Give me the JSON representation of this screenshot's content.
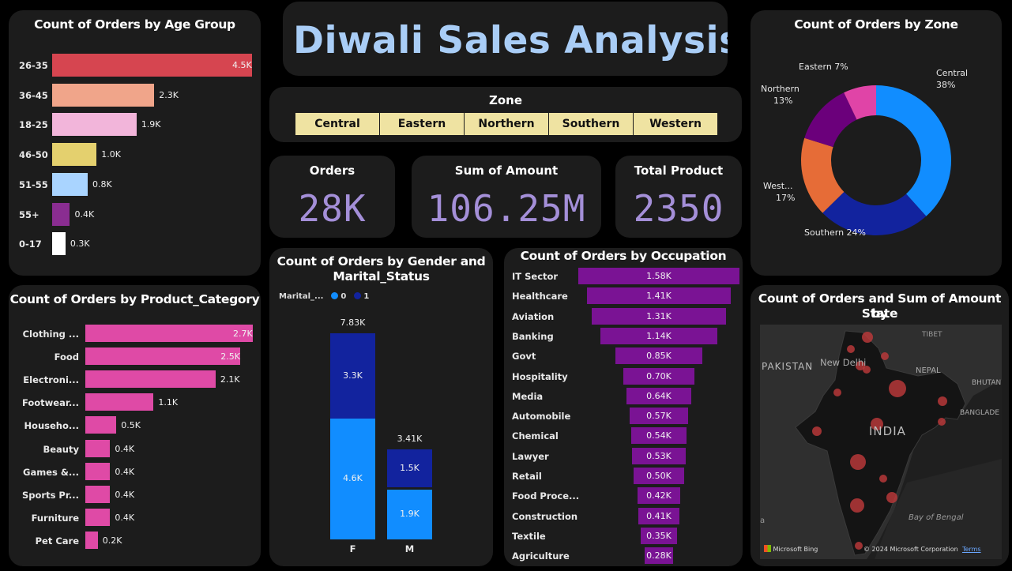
{
  "title": "Diwali Sales Analysis",
  "colors": {
    "background": "#000000",
    "card": "#1c1c1c",
    "title_text": "#a9cdf6",
    "kpi_value": "#a48fd8",
    "slicer_item": "#efe3a2",
    "category_bar": "#df4aa6",
    "occupation_bar": "#7a1394",
    "gender_0": "#118dff",
    "gender_1": "#12239e"
  },
  "zone_slicer": {
    "title": "Zone",
    "items": [
      "Central",
      "Eastern",
      "Northern",
      "Southern",
      "Western"
    ]
  },
  "kpis": {
    "orders": {
      "label": "Orders",
      "value": "28K"
    },
    "amount": {
      "label": "Sum of Amount",
      "value": "106.25M"
    },
    "products": {
      "label": "Total Product",
      "value": "2350"
    }
  },
  "age_chart": {
    "title": "Count of Orders by Age Group",
    "chart_data": {
      "type": "bar",
      "orientation": "horizontal",
      "categories": [
        "26-35",
        "36-45",
        "18-25",
        "46-50",
        "51-55",
        "55+",
        "0-17"
      ],
      "values": [
        4.5,
        2.3,
        1.9,
        1.0,
        0.8,
        0.4,
        0.3
      ],
      "unit": "K",
      "labels": [
        "4.5K",
        "2.3K",
        "1.9K",
        "1.0K",
        "0.8K",
        "0.4K",
        "0.3K"
      ],
      "colors": [
        "#d64550",
        "#f0a58a",
        "#f2b5da",
        "#e4d06e",
        "#a9d4ff",
        "#8a2d91",
        "#ffffff"
      ]
    }
  },
  "category_chart": {
    "title": "Count of Orders by Product_Category",
    "chart_data": {
      "type": "bar",
      "orientation": "horizontal",
      "categories": [
        "Clothing ...",
        "Food",
        "Electroni...",
        "Footwear...",
        "Househo...",
        "Beauty",
        "Games &...",
        "Sports Pr...",
        "Furniture",
        "Pet Care"
      ],
      "values": [
        2.7,
        2.5,
        2.1,
        1.1,
        0.5,
        0.4,
        0.4,
        0.4,
        0.4,
        0.2
      ],
      "unit": "K",
      "labels": [
        "2.7K",
        "2.5K",
        "2.1K",
        "1.1K",
        "0.5K",
        "0.4K",
        "0.4K",
        "0.4K",
        "0.4K",
        "0.2K"
      ]
    }
  },
  "gender_chart": {
    "title_line1": "Count of Orders by Gender and",
    "title_line2": "Marital_Status",
    "legend_title": "Marital_...",
    "chart_data": {
      "type": "bar",
      "stacked": true,
      "categories": [
        "F",
        "M"
      ],
      "series": [
        {
          "name": "0",
          "values": [
            4.6,
            1.9
          ],
          "labels": [
            "4.6K",
            "1.9K"
          ]
        },
        {
          "name": "1",
          "values": [
            3.3,
            1.5
          ],
          "labels": [
            "3.3K",
            "1.5K"
          ]
        }
      ],
      "totals": [
        7.83,
        3.41
      ],
      "total_labels": [
        "7.83K",
        "3.41K"
      ],
      "unit": "K"
    }
  },
  "occupation_chart": {
    "title": "Count of Orders by Occupation",
    "chart_data": {
      "type": "bar",
      "orientation": "horizontal",
      "style": "funnel",
      "categories": [
        "IT Sector",
        "Healthcare",
        "Aviation",
        "Banking",
        "Govt",
        "Hospitality",
        "Media",
        "Automobile",
        "Chemical",
        "Lawyer",
        "Retail",
        "Food Proce...",
        "Construction",
        "Textile",
        "Agriculture"
      ],
      "values": [
        1.58,
        1.41,
        1.31,
        1.14,
        0.85,
        0.7,
        0.64,
        0.57,
        0.54,
        0.53,
        0.5,
        0.42,
        0.41,
        0.35,
        0.28
      ],
      "unit": "K",
      "labels": [
        "1.58K",
        "1.41K",
        "1.31K",
        "1.14K",
        "0.85K",
        "0.70K",
        "0.64K",
        "0.57K",
        "0.54K",
        "0.53K",
        "0.50K",
        "0.42K",
        "0.41K",
        "0.35K",
        "0.28K"
      ]
    }
  },
  "zone_chart": {
    "title": "Count of Orders by Zone",
    "chart_data": {
      "type": "pie",
      "donut": true,
      "categories": [
        "Central",
        "Southern",
        "Western",
        "Northern",
        "Eastern"
      ],
      "values": [
        38,
        24,
        17,
        13,
        7
      ],
      "unit": "%",
      "colors": [
        "#118dff",
        "#12239e",
        "#e66c37",
        "#6b007b",
        "#e044a7"
      ],
      "label_names": [
        "Central",
        "Southern",
        "West...",
        "Northern",
        "Eastern"
      ],
      "label_values": [
        "38%",
        "24%",
        "17%",
        "13%",
        "7%"
      ]
    }
  },
  "map_chart": {
    "title_line1": "Count of Orders and Sum of Amount by",
    "title_line2": "State",
    "map_labels": {
      "pakistan": "PAKISTAN",
      "new_delhi": "New Delhi",
      "nepal": "NEPAL",
      "tibet": "TIBET",
      "bhutan": "BHUTAN",
      "bangladesh": "BANGLADE",
      "india": "INDIA",
      "bay_of_bengal": "Bay of Bengal",
      "edge_a": "a"
    },
    "attribution": "Microsoft Bing",
    "copyright": "© 2024 Microsoft Corporation",
    "terms": "Terms",
    "bubble_color": "#c0393b"
  }
}
